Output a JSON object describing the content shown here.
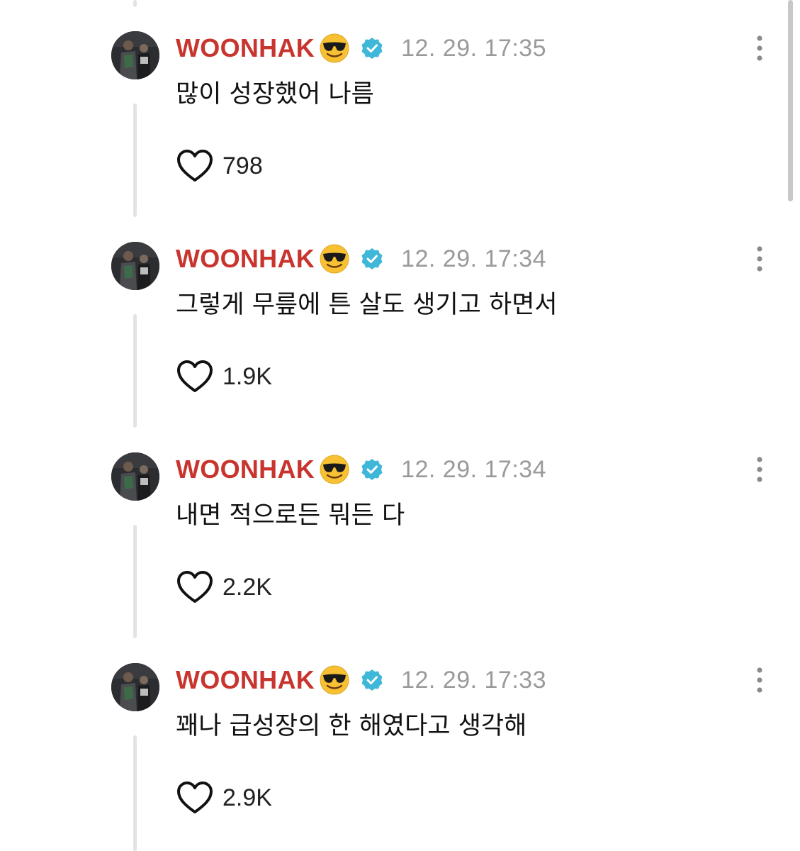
{
  "posts": [
    {
      "username": "WOONHAK",
      "emoji": "smiling-face-with-sunglasses",
      "verified": true,
      "timestamp": "12. 29. 17:35",
      "text": "많이 성장했어 나름",
      "likes": "798"
    },
    {
      "username": "WOONHAK",
      "emoji": "smiling-face-with-sunglasses",
      "verified": true,
      "timestamp": "12. 29. 17:34",
      "text": "그렇게 무릎에 튼 살도 생기고 하면서",
      "likes": "1.9K"
    },
    {
      "username": "WOONHAK",
      "emoji": "smiling-face-with-sunglasses",
      "verified": true,
      "timestamp": "12. 29. 17:34",
      "text": "내면 적으로든 뭐든 다",
      "likes": "2.2K"
    },
    {
      "username": "WOONHAK",
      "emoji": "smiling-face-with-sunglasses",
      "verified": true,
      "timestamp": "12. 29. 17:33",
      "text": "꽤나 급성장의 한 해였다고 생각해",
      "likes": "2.9K"
    }
  ],
  "colors": {
    "username": "#c8342e",
    "timestamp": "#9a9a9a",
    "verified_badge": "#3fb7d8",
    "thread_line": "#e3e3e3"
  },
  "icons": {
    "verified": "verified-badge-icon",
    "like": "heart-outline-icon",
    "more": "more-vertical-icon"
  }
}
